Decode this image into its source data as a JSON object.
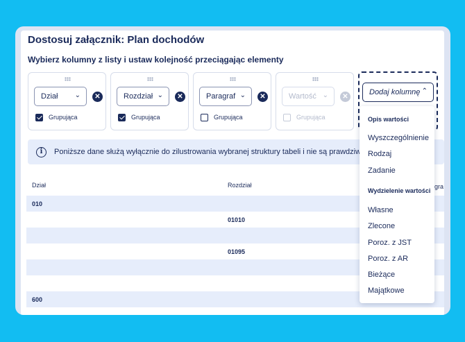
{
  "page": {
    "title": "Dostosuj załącznik: Plan dochodów",
    "subtitle": "Wybierz kolumny z listy i ustaw kolejność przeciągając elementy"
  },
  "columns": [
    {
      "label": "Dział",
      "checkbox_label": "Grupująca",
      "checked": true,
      "disabled": false
    },
    {
      "label": "Rozdział",
      "checkbox_label": "Grupująca",
      "checked": true,
      "disabled": false
    },
    {
      "label": "Paragraf",
      "checkbox_label": "Grupująca",
      "checked": false,
      "disabled": false
    },
    {
      "label": "Wartość",
      "checkbox_label": "Grupująca",
      "checked": false,
      "disabled": true
    }
  ],
  "add_column": {
    "label": "Dodaj kolumnę",
    "open": true,
    "groups": [
      {
        "header": "Opis wartości",
        "items": [
          "Wyszczególnienie",
          "Rodzaj",
          "Zadanie"
        ]
      },
      {
        "header": "Wydzielenie wartości",
        "items": [
          "Własne",
          "Zlecone",
          "Poroz. z JST",
          "Poroz. z AR",
          "Bieżące",
          "Majątkowe"
        ]
      }
    ]
  },
  "info": {
    "text": "Poniższe dane służą wyłącznie do zilustrowania wybranej struktury tabeli i nie są prawdziwymi informacjami"
  },
  "table": {
    "headers": [
      "Dział",
      "Rozdział",
      "Paragraf"
    ],
    "rows": [
      {
        "dzial": "010",
        "rozdzial": ""
      },
      {
        "dzial": "",
        "rozdzial": "01010"
      },
      {
        "dzial": "",
        "rozdzial": ""
      },
      {
        "dzial": "",
        "rozdzial": "01095"
      },
      {
        "dzial": "",
        "rozdzial": ""
      },
      {
        "dzial": "",
        "rozdzial": ""
      },
      {
        "dzial": "600",
        "rozdzial": ""
      }
    ]
  },
  "colors": {
    "background": "#12bdf2",
    "primary": "#1a2a5a",
    "row_shade": "#e6edfb"
  }
}
